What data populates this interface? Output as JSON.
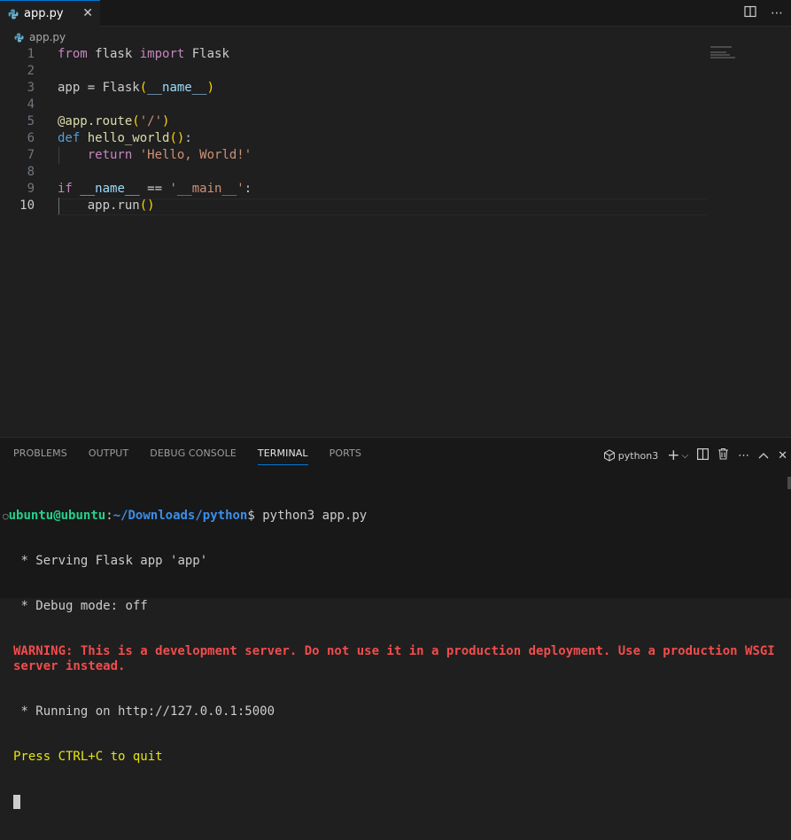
{
  "tab": {
    "filename": "app.py",
    "close": "✕"
  },
  "breadcrumb": {
    "file": "app.py"
  },
  "editor": {
    "line_numbers": [
      "1",
      "2",
      "3",
      "4",
      "5",
      "6",
      "7",
      "8",
      "9",
      "10"
    ],
    "active_line": 10
  },
  "panel": {
    "tabs": [
      "PROBLEMS",
      "OUTPUT",
      "DEBUG CONSOLE",
      "TERMINAL",
      "PORTS"
    ],
    "active_tab": "TERMINAL",
    "terminal_name": "python3"
  },
  "terminal": {
    "prompt_user": "ubuntu@ubuntu",
    "prompt_sep": ":",
    "prompt_path": "~/Downloads/python",
    "prompt_end": "$",
    "command": " python3 app.py",
    "line_serving": " * Serving Flask app 'app'",
    "line_debug": " * Debug mode: off",
    "line_warning": "WARNING: This is a development server. Do not use it in a production deployment. Use a production WSGI server instead.",
    "line_running": " * Running on http://127.0.0.1:5000",
    "line_quit": "Press CTRL+C to quit"
  },
  "colors": {
    "accent": "#0078d4",
    "prompt_user": "#23d18b",
    "prompt_path": "#3b8eea",
    "warning": "#f14c4c"
  }
}
